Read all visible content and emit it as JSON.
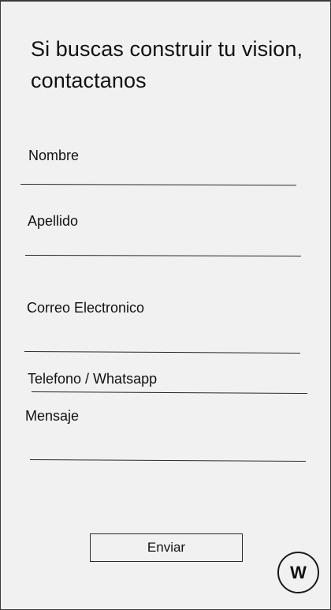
{
  "header": {
    "title": "Si buscas construir tu vision, contactanos"
  },
  "form": {
    "fields": [
      {
        "label": "Nombre",
        "value": ""
      },
      {
        "label": "Apellido",
        "value": ""
      },
      {
        "label": "Correo Electronico",
        "value": ""
      },
      {
        "label": "Telefono / Whatsapp",
        "value": ""
      },
      {
        "label": "Mensaje",
        "value": ""
      }
    ],
    "submit_label": "Enviar"
  },
  "floating_button": {
    "label": "W",
    "icon": "whatsapp-icon"
  }
}
